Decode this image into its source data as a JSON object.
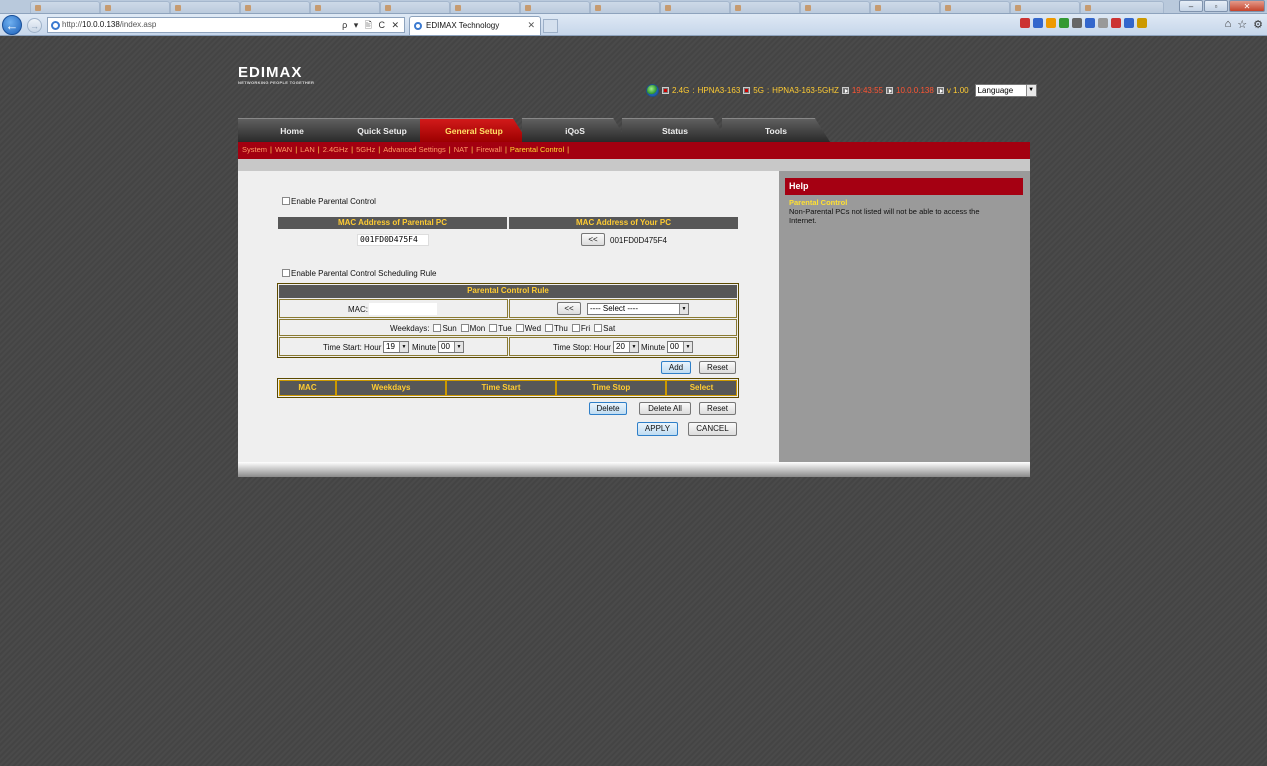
{
  "browser": {
    "url_prefix": "http://",
    "url_host": "10.0.0.138",
    "url_path": "/index.asp",
    "addr_tools": "ρ ▾ 🖹 C ✕",
    "tab_title": "EDIMAX Technology",
    "tab_close": "✕",
    "win_min": "–",
    "win_max": "▫",
    "win_close": "✕"
  },
  "logo": {
    "name": "EDIMAX",
    "tagline": "NETWORKING PEOPLE TOGETHER"
  },
  "status": {
    "band_24": "2.4G",
    "ssid_24": "HPNA3-163",
    "band_5": "5G",
    "ssid_5": "HPNA3-163-5GHZ",
    "time": "19:43:55",
    "ip": "10.0.0.138",
    "version": "v 1.00",
    "language": "Language"
  },
  "tabs": [
    "Home",
    "Quick Setup",
    "General Setup",
    "iQoS",
    "Status",
    "Tools"
  ],
  "subnav": [
    "System",
    "WAN",
    "LAN",
    "2.4GHz",
    "5GHz",
    "Advanced Settings",
    "NAT",
    "Firewall",
    "Parental Control"
  ],
  "form": {
    "enable_pc": "Enable Parental Control",
    "mac_parental_hdr": "MAC Address of Parental PC",
    "mac_your_hdr": "MAC Address of Your PC",
    "mac_parental_value": "001FD0D475F4",
    "copy_btn": "<<",
    "mac_your_value": "001FD0D475F4",
    "enable_sched": "Enable Parental Control Scheduling Rule",
    "rule_hdr": "Parental Control Rule",
    "mac_label": "MAC:",
    "mac_value": "",
    "copy_btn2": "<<",
    "select_placeholder": "---- Select ----",
    "weekdays_label": "Weekdays:",
    "days": [
      "Sun",
      "Mon",
      "Tue",
      "Wed",
      "Thu",
      "Fri",
      "Sat"
    ],
    "time_start_label": "Time Start: Hour",
    "start_hour": "19",
    "minute_label": "Minute",
    "start_minute": "00",
    "time_stop_label": "Time Stop: Hour",
    "stop_hour": "20",
    "stop_minute": "00",
    "add_btn": "Add",
    "reset_btn": "Reset",
    "list_headers": [
      "MAC",
      "Weekdays",
      "Time Start",
      "Time Stop",
      "Select"
    ],
    "delete_btn": "Delete",
    "delete_all_btn": "Delete All",
    "reset_btn2": "Reset",
    "apply_btn": "APPLY",
    "cancel_btn": "CANCEL"
  },
  "help": {
    "title": "Help",
    "subtitle": "Parental Control",
    "text": "Non-Parental PCs not listed will not be able to access the Internet."
  },
  "colors": {
    "accent_red": "#a30010",
    "tab_active": "#c40000",
    "gold": "#ffcc33"
  }
}
